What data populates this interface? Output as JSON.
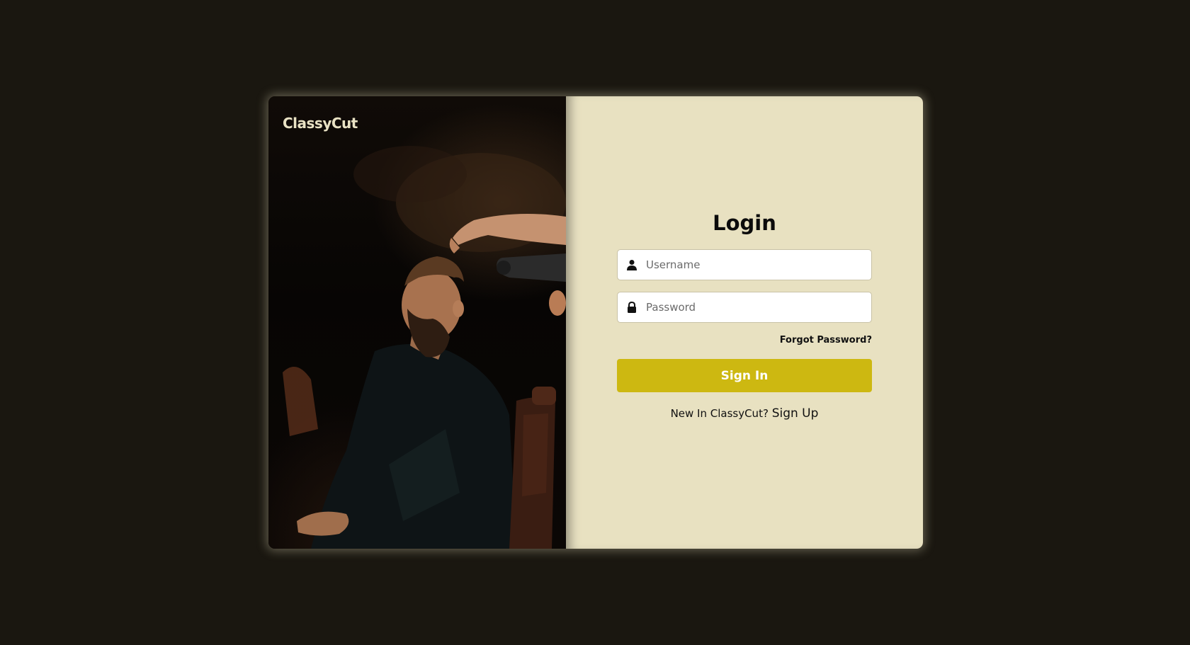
{
  "brand": {
    "name": "ClassyCut"
  },
  "login": {
    "title": "Login",
    "username_placeholder": "Username",
    "password_placeholder": "Password",
    "forgot_label": "Forgot Password?",
    "signin_label": "Sign In",
    "signup_prompt": "New In ClassyCut?",
    "signup_label": "Sign Up"
  },
  "icons": {
    "username": "user-icon",
    "password": "lock-icon"
  },
  "colors": {
    "page_background": "#1a1710",
    "form_background": "#e8e1c1",
    "accent": "#cdb811",
    "brand_text": "#e9e2c4"
  }
}
